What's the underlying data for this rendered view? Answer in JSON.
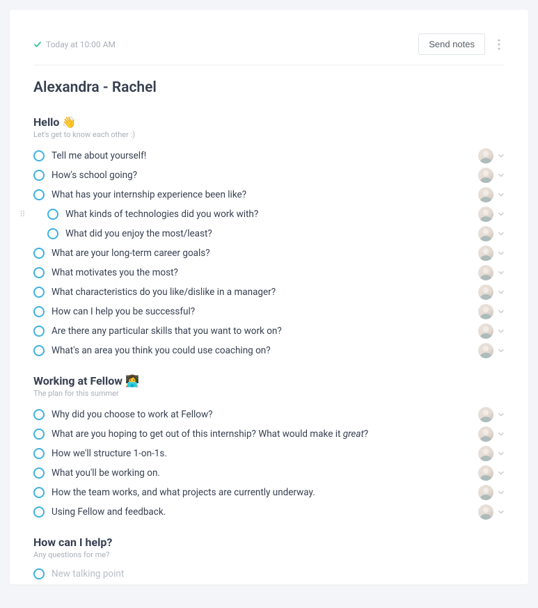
{
  "header": {
    "timestamp": "Today at 10:00 AM",
    "send_label": "Send notes"
  },
  "title": "Alexandra - Rachel",
  "sections": [
    {
      "title": "Hello 👋",
      "subtitle": "Let's get to know each other :)",
      "items": [
        {
          "text": "Tell me about yourself!",
          "nested": false,
          "drag": false
        },
        {
          "text": "How's school going?",
          "nested": false,
          "drag": false
        },
        {
          "text": "What has your internship experience been like?",
          "nested": false,
          "drag": false
        },
        {
          "text": "What kinds of technologies did you work with?",
          "nested": true,
          "drag": true
        },
        {
          "text": "What did you enjoy the most/least?",
          "nested": true,
          "drag": false
        },
        {
          "text": "What are your long-term career goals?",
          "nested": false,
          "drag": false
        },
        {
          "text": "What motivates you the most?",
          "nested": false,
          "drag": false
        },
        {
          "text": "What characteristics do you like/dislike in a manager?",
          "nested": false,
          "drag": false
        },
        {
          "text": "How can I help you be successful?",
          "nested": false,
          "drag": false
        },
        {
          "text": "Are there any particular skills that you want to work on?",
          "nested": false,
          "drag": false
        },
        {
          "text": "What's an area you think you could use coaching on?",
          "nested": false,
          "drag": false
        }
      ]
    },
    {
      "title": "Working at Fellow 👩‍💻",
      "subtitle": "The plan for this summer",
      "items": [
        {
          "text": "Why did you choose to work at Fellow?",
          "nested": false,
          "drag": false
        },
        {
          "text_html": "What are you hoping to get out of this internship? What would make it <span class=\"italic\">great</span>?",
          "nested": false,
          "drag": false
        },
        {
          "text": "How we'll structure 1-on-1s.",
          "nested": false,
          "drag": false
        },
        {
          "text": "What you'll be working on.",
          "nested": false,
          "drag": false
        },
        {
          "text": "How the team works, and what projects are currently underway.",
          "nested": false,
          "drag": false
        },
        {
          "text": "Using Fellow and feedback.",
          "nested": false,
          "drag": false
        }
      ]
    },
    {
      "title": "How can I help?",
      "subtitle": "Any questions for me?",
      "items": [
        {
          "placeholder": "New talking point",
          "nested": false,
          "drag": false,
          "empty": true
        }
      ]
    }
  ]
}
